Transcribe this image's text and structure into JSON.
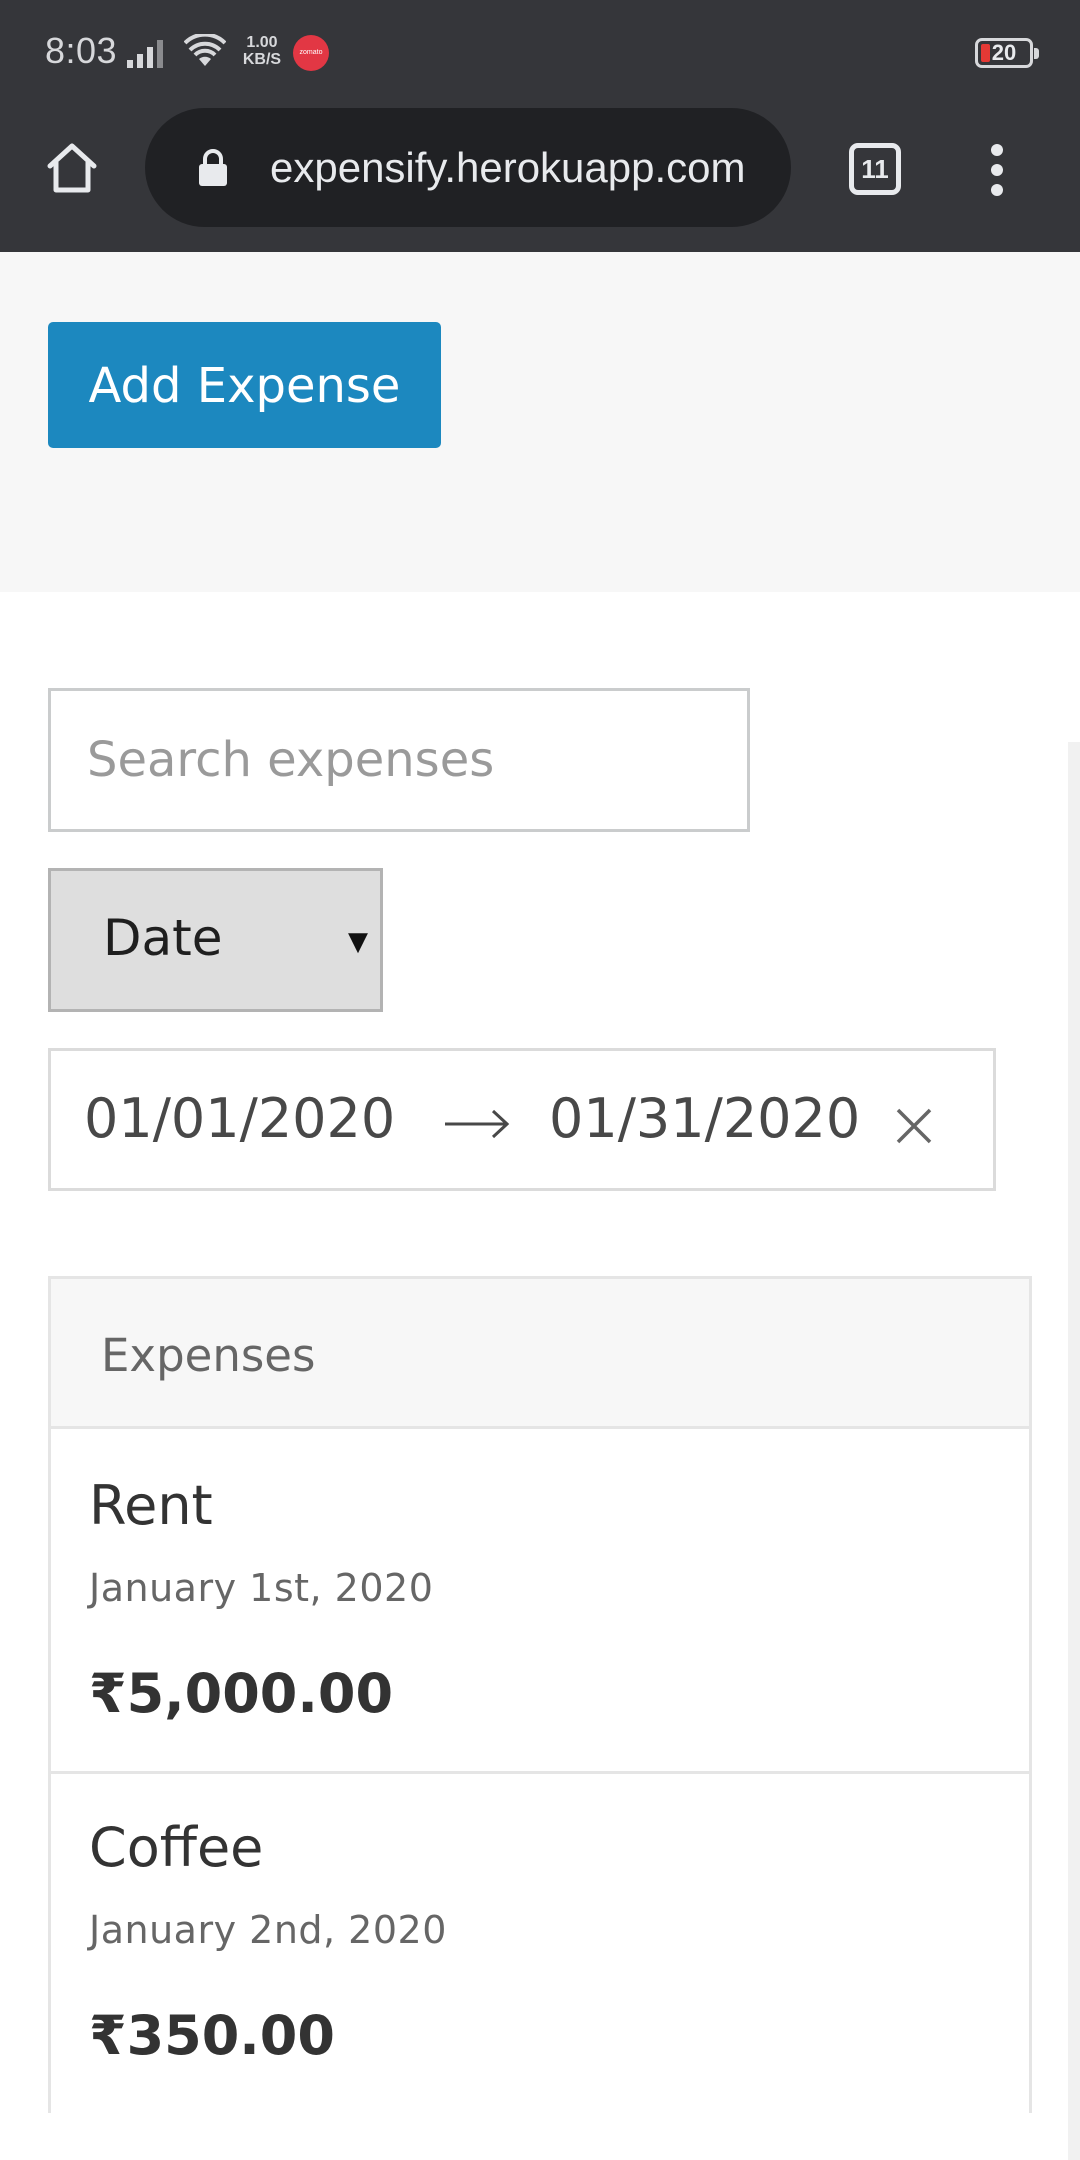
{
  "status_bar": {
    "time": "8:03",
    "net_speed_value": "1.00",
    "net_speed_unit": "KB/S",
    "notification_app": "zomato",
    "battery_level": "20",
    "icons": [
      "signal-icon",
      "wifi-icon",
      "zomato-icon",
      "battery-icon"
    ]
  },
  "browser": {
    "url": "expensify.herokuapp.com",
    "tab_count": "11",
    "icons": [
      "home-icon",
      "lock-icon",
      "tab-switcher-icon",
      "more-vert-icon"
    ]
  },
  "header": {
    "add_expense_label": "Add Expense",
    "accent_color": "#1c88bf"
  },
  "filters": {
    "search_placeholder": "Search expenses",
    "search_value": "",
    "sort_by": "Date",
    "sort_options_visible": [
      "Date"
    ],
    "start_date": "01/01/2020",
    "end_date": "01/31/2020",
    "icons": [
      "arrow-right-icon",
      "clear-icon",
      "caret-down-icon"
    ]
  },
  "expenses": {
    "header_label": "Expenses",
    "items": [
      {
        "description": "Rent",
        "date": "January 1st, 2020",
        "amount": "₹5,000.00"
      },
      {
        "description": "Coffee",
        "date": "January 2nd, 2020",
        "amount": "₹350.00"
      }
    ]
  }
}
